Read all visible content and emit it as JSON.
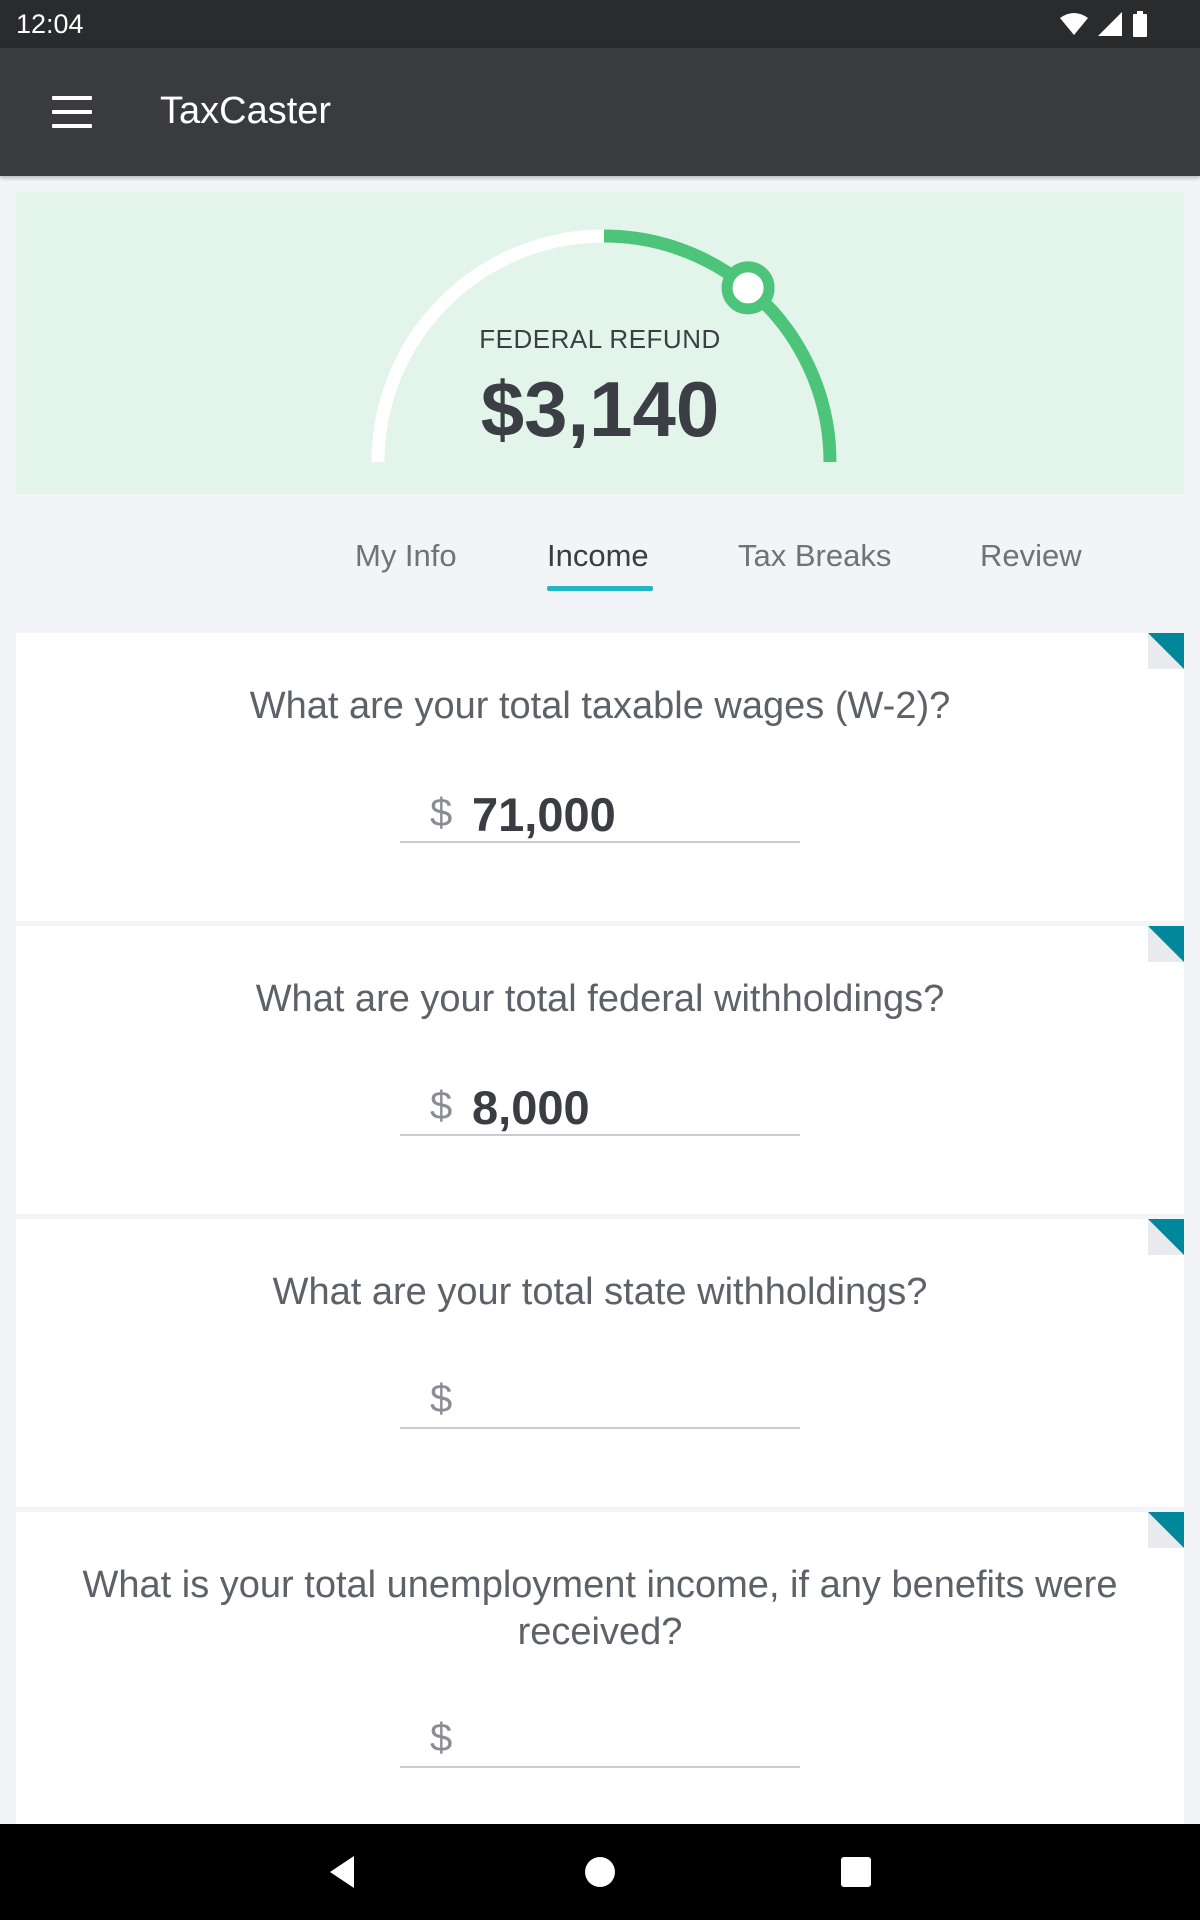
{
  "status_bar": {
    "time": "12:04"
  },
  "app_bar": {
    "title": "TaxCaster",
    "menu_icon": "hamburger-menu-icon"
  },
  "refund": {
    "label": "FEDERAL REFUND",
    "amount": "$3,140",
    "gauge_progress": 0.22,
    "gauge_color": "#4cc47a"
  },
  "tabs": [
    {
      "label": "My Info",
      "active": false
    },
    {
      "label": "Income",
      "active": true
    },
    {
      "label": "Tax Breaks",
      "active": false
    },
    {
      "label": "Review",
      "active": false
    }
  ],
  "questions": [
    {
      "text": "What are your total taxable wages (W-2)?",
      "currency": "$",
      "value": "71,000"
    },
    {
      "text": "What are your total federal withholdings?",
      "currency": "$",
      "value": "8,000"
    },
    {
      "text": "What are your total state withholdings?",
      "currency": "$",
      "value": ""
    },
    {
      "text": "What is your total unemployment income, if any benefits were received?",
      "currency": "$",
      "value": ""
    }
  ],
  "colors": {
    "accent": "#25b6c5",
    "corner_flag": "#00889a",
    "appbar": "#3a3b3e",
    "refund_bg": "#e3f4ea"
  }
}
